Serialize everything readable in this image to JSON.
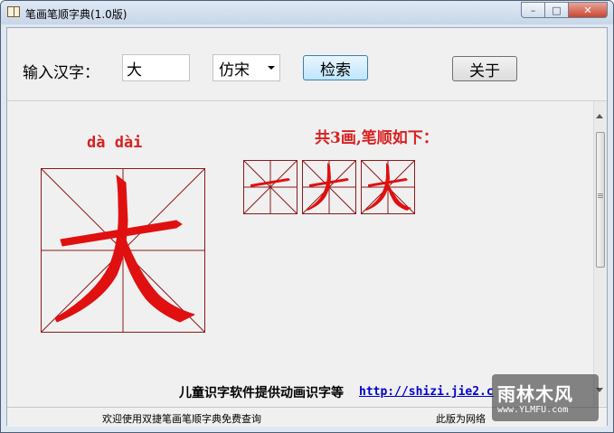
{
  "window": {
    "title": "笔画笔顺字典(1.0版)",
    "controls": {
      "minimize": "–",
      "maximize": "□",
      "close": "✕"
    }
  },
  "toolbar": {
    "input_label": "输入汉字：",
    "char_value": "大",
    "font_value": "仿宋",
    "search_label": "检索",
    "about_label": "关于"
  },
  "result": {
    "pinyin": "dà dài",
    "stroke_summary": "共3画,笔顺如下：",
    "character": "大",
    "stroke_count": 3
  },
  "promo": {
    "text": "儿童识字软件提供动画识字等",
    "link": "http://shizi.jie2.c"
  },
  "status": {
    "left": "欢迎使用双捷笔画笔顺字典免费查询",
    "right": "此版为网络"
  },
  "watermark": {
    "top": "雨林木风",
    "bottom": "www.YLMFU.com"
  },
  "colors": {
    "stroke": "#e01010",
    "grid": "#8b1a1a",
    "accent_text": "#d81f1f",
    "link": "#0000cc"
  }
}
